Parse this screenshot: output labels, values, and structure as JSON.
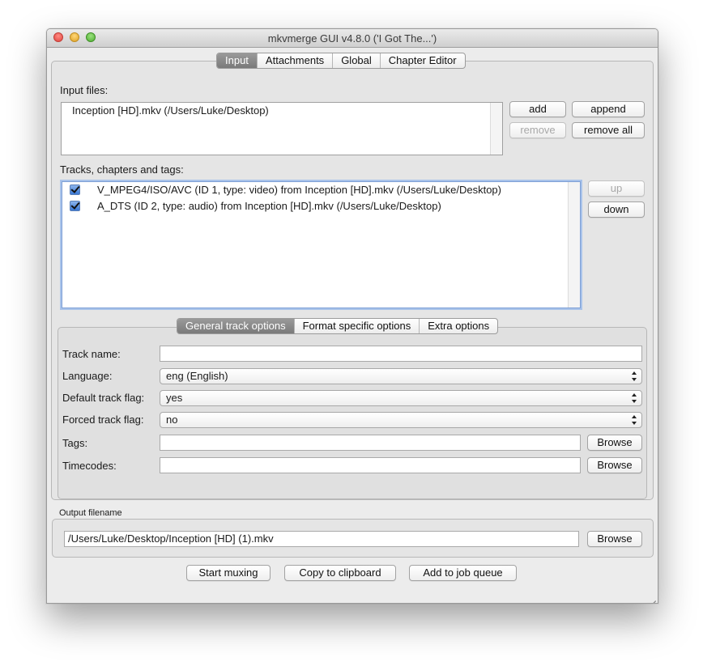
{
  "window": {
    "title": "mkvmerge GUI v4.8.0 ('I Got The...')"
  },
  "main_tabs": [
    {
      "label": "Input",
      "selected": true
    },
    {
      "label": "Attachments",
      "selected": false
    },
    {
      "label": "Global",
      "selected": false
    },
    {
      "label": "Chapter Editor",
      "selected": false
    }
  ],
  "input": {
    "files_label": "Input files:",
    "files": [
      "Inception [HD].mkv (/Users/Luke/Desktop)"
    ],
    "buttons": {
      "add": "add",
      "append": "append",
      "remove": "remove",
      "remove_all": "remove all"
    },
    "tracks_label": "Tracks, chapters and tags:",
    "tracks": [
      {
        "checked": true,
        "label": "V_MPEG4/ISO/AVC (ID 1, type: video) from Inception [HD].mkv (/Users/Luke/Desktop)"
      },
      {
        "checked": true,
        "label": "A_DTS (ID 2, type: audio) from Inception [HD].mkv (/Users/Luke/Desktop)"
      }
    ],
    "track_buttons": {
      "up": "up",
      "down": "down"
    }
  },
  "track_tabs": [
    {
      "label": "General track options",
      "selected": true
    },
    {
      "label": "Format specific options",
      "selected": false
    },
    {
      "label": "Extra options",
      "selected": false
    }
  ],
  "track_options": {
    "track_name_label": "Track name:",
    "track_name_value": "",
    "language_label": "Language:",
    "language_value": "eng (English)",
    "default_flag_label": "Default track flag:",
    "default_flag_value": "yes",
    "forced_flag_label": "Forced track flag:",
    "forced_flag_value": "no",
    "tags_label": "Tags:",
    "tags_value": "",
    "timecodes_label": "Timecodes:",
    "timecodes_value": "",
    "browse_label": "Browse"
  },
  "output": {
    "label": "Output filename",
    "value": "/Users/Luke/Desktop/Inception [HD] (1).mkv",
    "browse_label": "Browse"
  },
  "bottom_buttons": {
    "start": "Start muxing",
    "copy": "Copy to clipboard",
    "queue": "Add to job queue"
  }
}
